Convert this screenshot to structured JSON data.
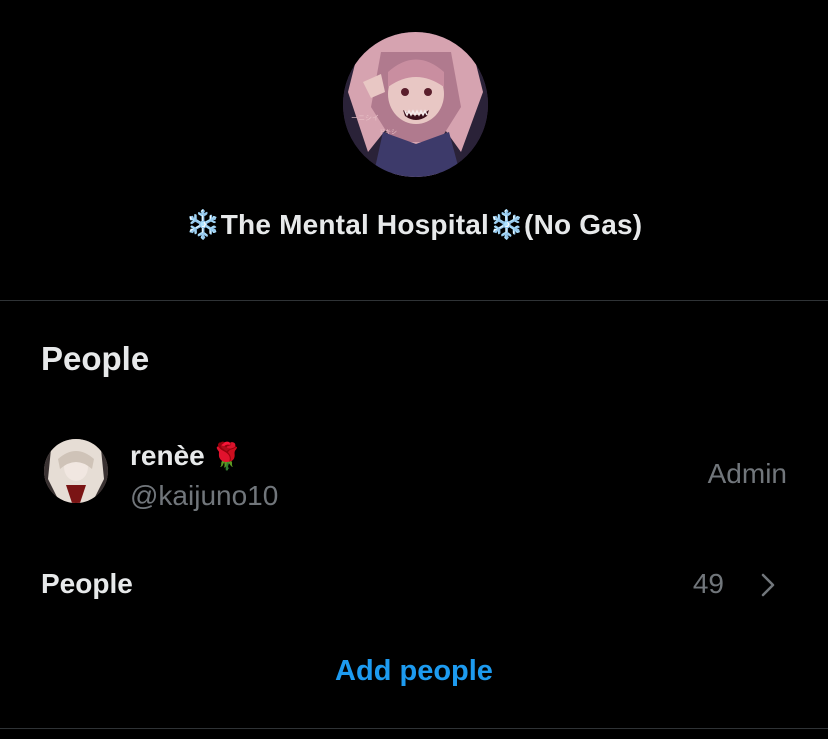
{
  "group": {
    "avatar_icon": "group-avatar-image",
    "name": "❄️The Mental Hospital❄️(No Gas)"
  },
  "people_section": {
    "title": "People",
    "members": [
      {
        "name": "renèe",
        "emoji": "🌹",
        "handle": "@kaijuno10",
        "role": "Admin",
        "avatar_icon": "member-avatar-image"
      }
    ],
    "people_row": {
      "label": "People",
      "count": "49",
      "chevron_icon": "chevron-right-icon"
    },
    "add_people_label": "Add people"
  },
  "colors": {
    "background": "#000000",
    "primary_text": "#e7e9ea",
    "secondary_text": "#71767b",
    "accent": "#1d9bf0",
    "divider": "#2f3336"
  }
}
